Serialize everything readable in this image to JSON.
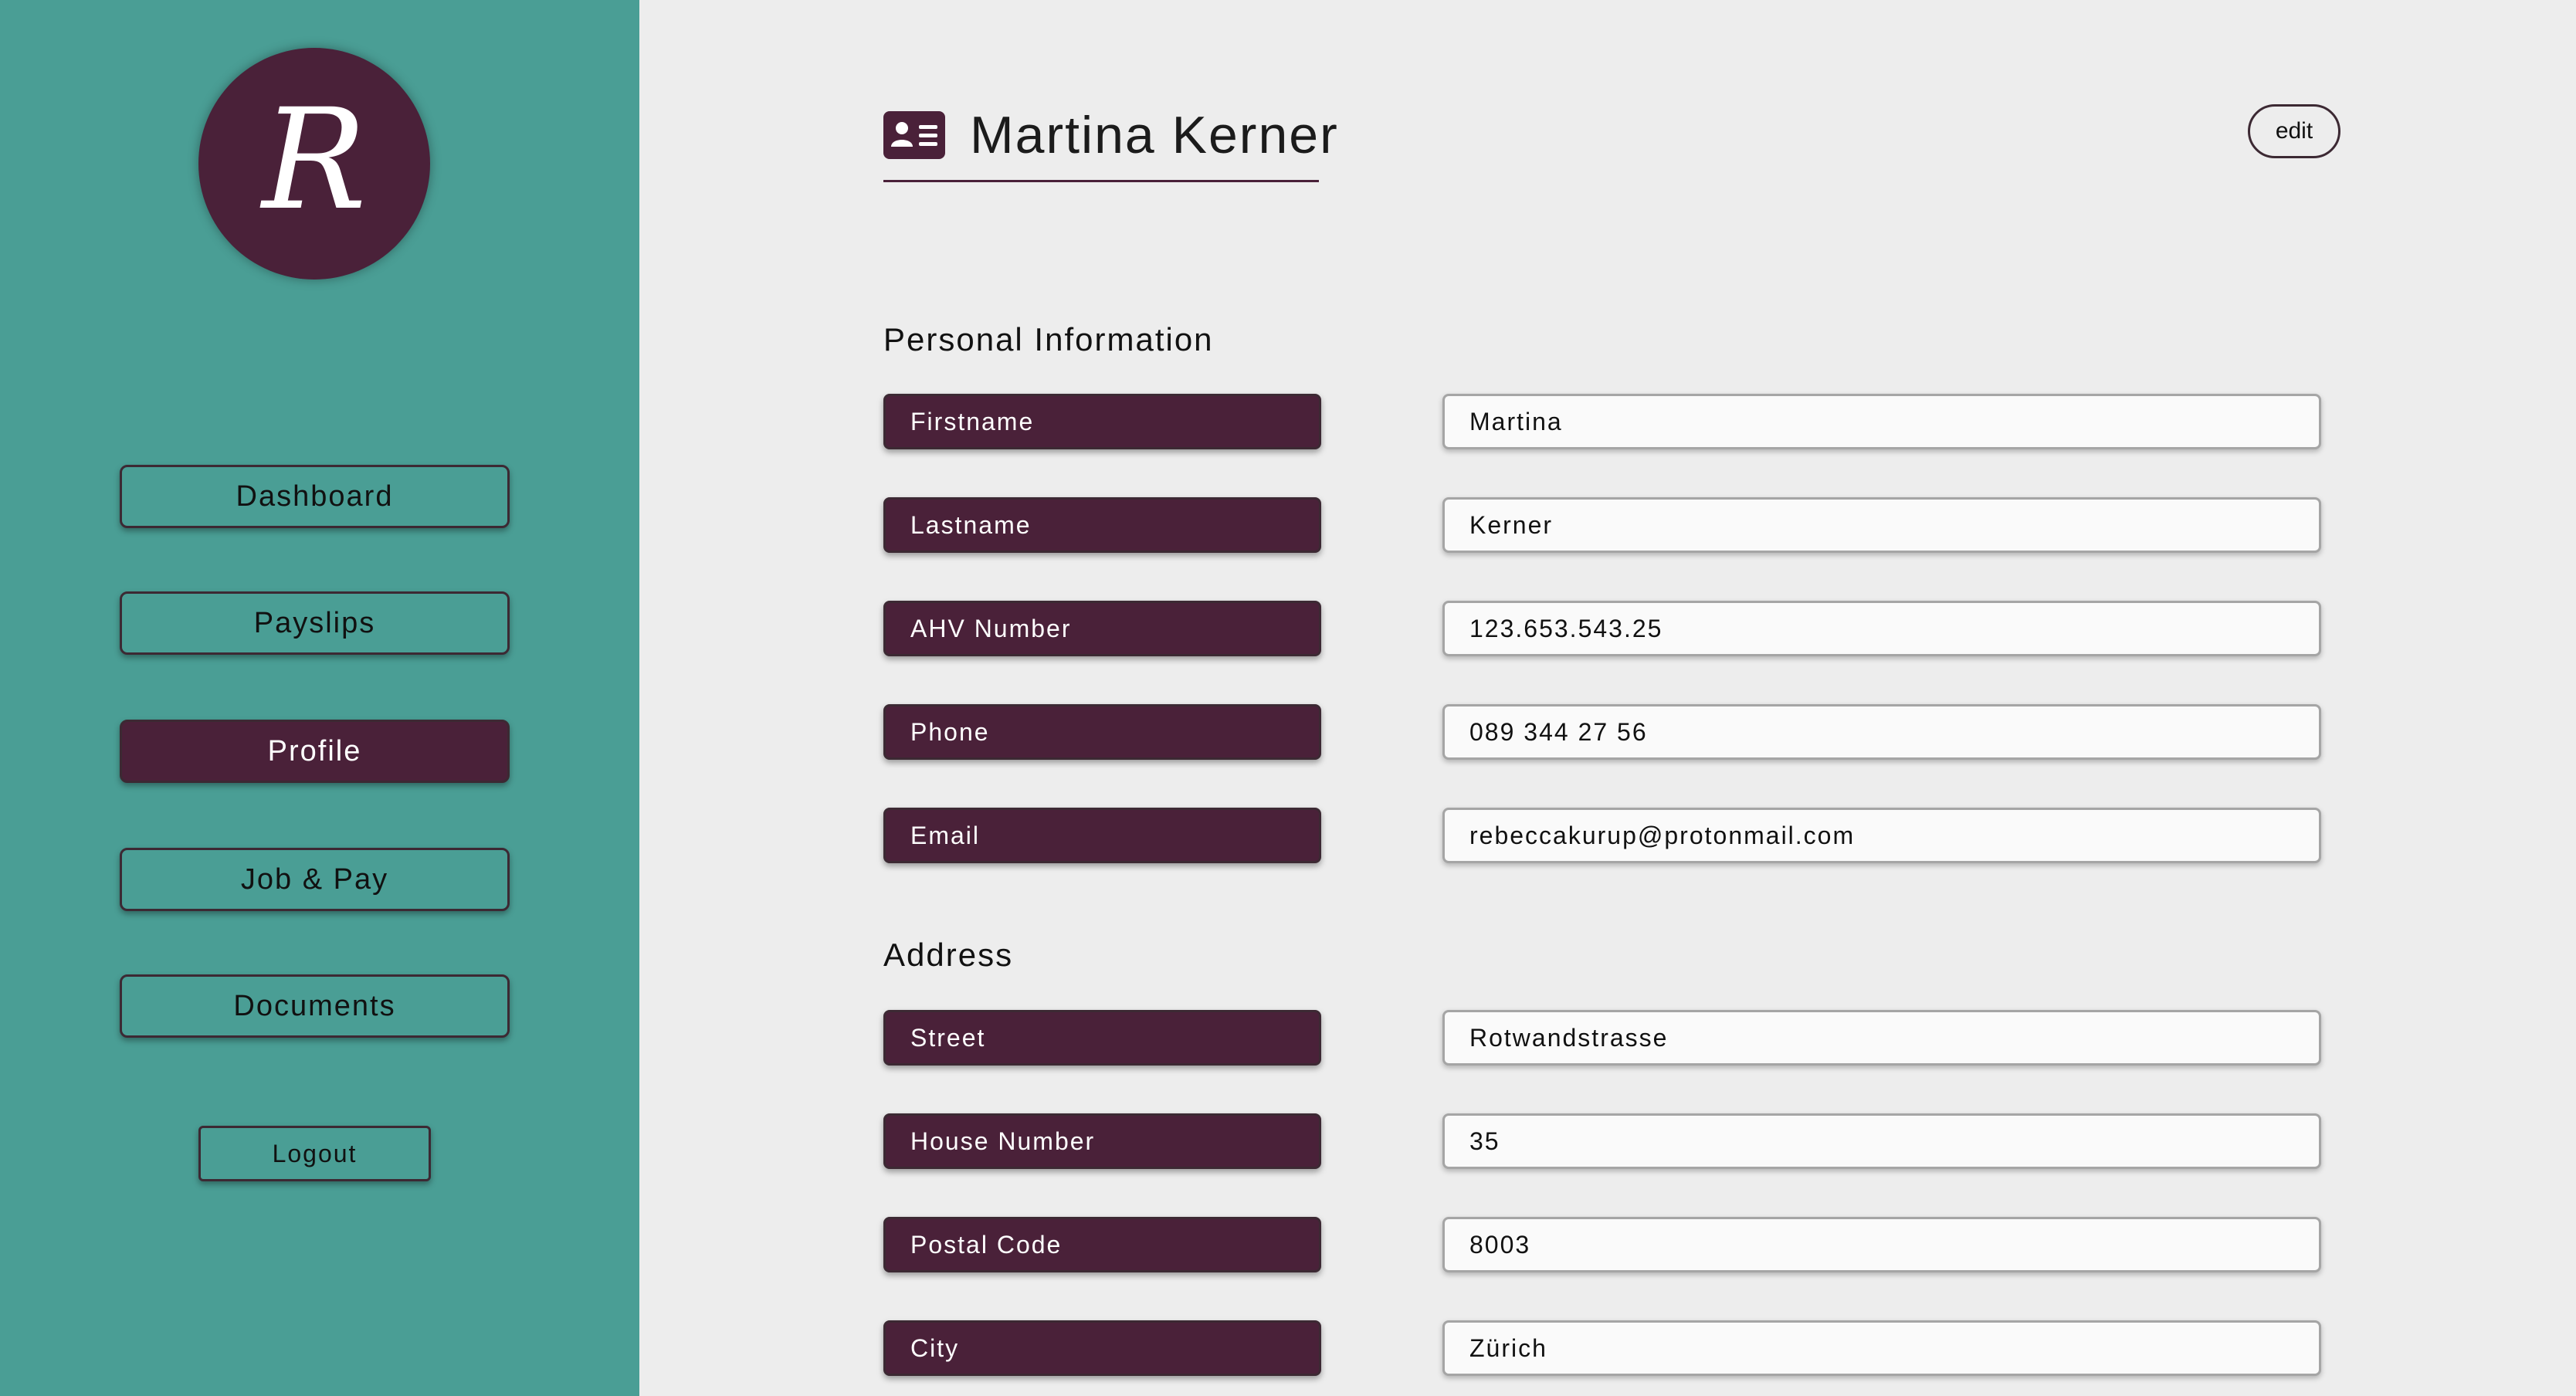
{
  "sidebar": {
    "avatar_letter": "R",
    "nav": {
      "dashboard": "Dashboard",
      "payslips": "Payslips",
      "profile": "Profile",
      "job_pay": "Job & Pay",
      "documents": "Documents"
    },
    "active_item": "Profile",
    "logout": "Logout"
  },
  "header": {
    "icon": "contact-card-icon",
    "name": "Martina Kerner",
    "edit_label": "edit"
  },
  "personal_information": {
    "title": "Personal Information",
    "fields": {
      "firstname": {
        "label": "Firstname",
        "value": "Martina"
      },
      "lastname": {
        "label": "Lastname",
        "value": "Kerner"
      },
      "ahv_number": {
        "label": "AHV Number",
        "value": "123.653.543.25"
      },
      "phone": {
        "label": "Phone",
        "value": "089 344 27 56"
      },
      "email": {
        "label": "Email",
        "value": "rebeccakurup@protonmail.com"
      }
    }
  },
  "address": {
    "title": "Address",
    "fields": {
      "street": {
        "label": "Street",
        "value": "Rotwandstrasse"
      },
      "house_number": {
        "label": "House Number",
        "value": "35"
      },
      "postal_code": {
        "label": "Postal Code",
        "value": "8003"
      },
      "city": {
        "label": "City",
        "value": "Zürich"
      }
    }
  },
  "colors": {
    "sidebar_bg": "#4a9e95",
    "accent": "#4a2139",
    "page_bg": "#ededed",
    "field_bg": "#fafafa"
  }
}
